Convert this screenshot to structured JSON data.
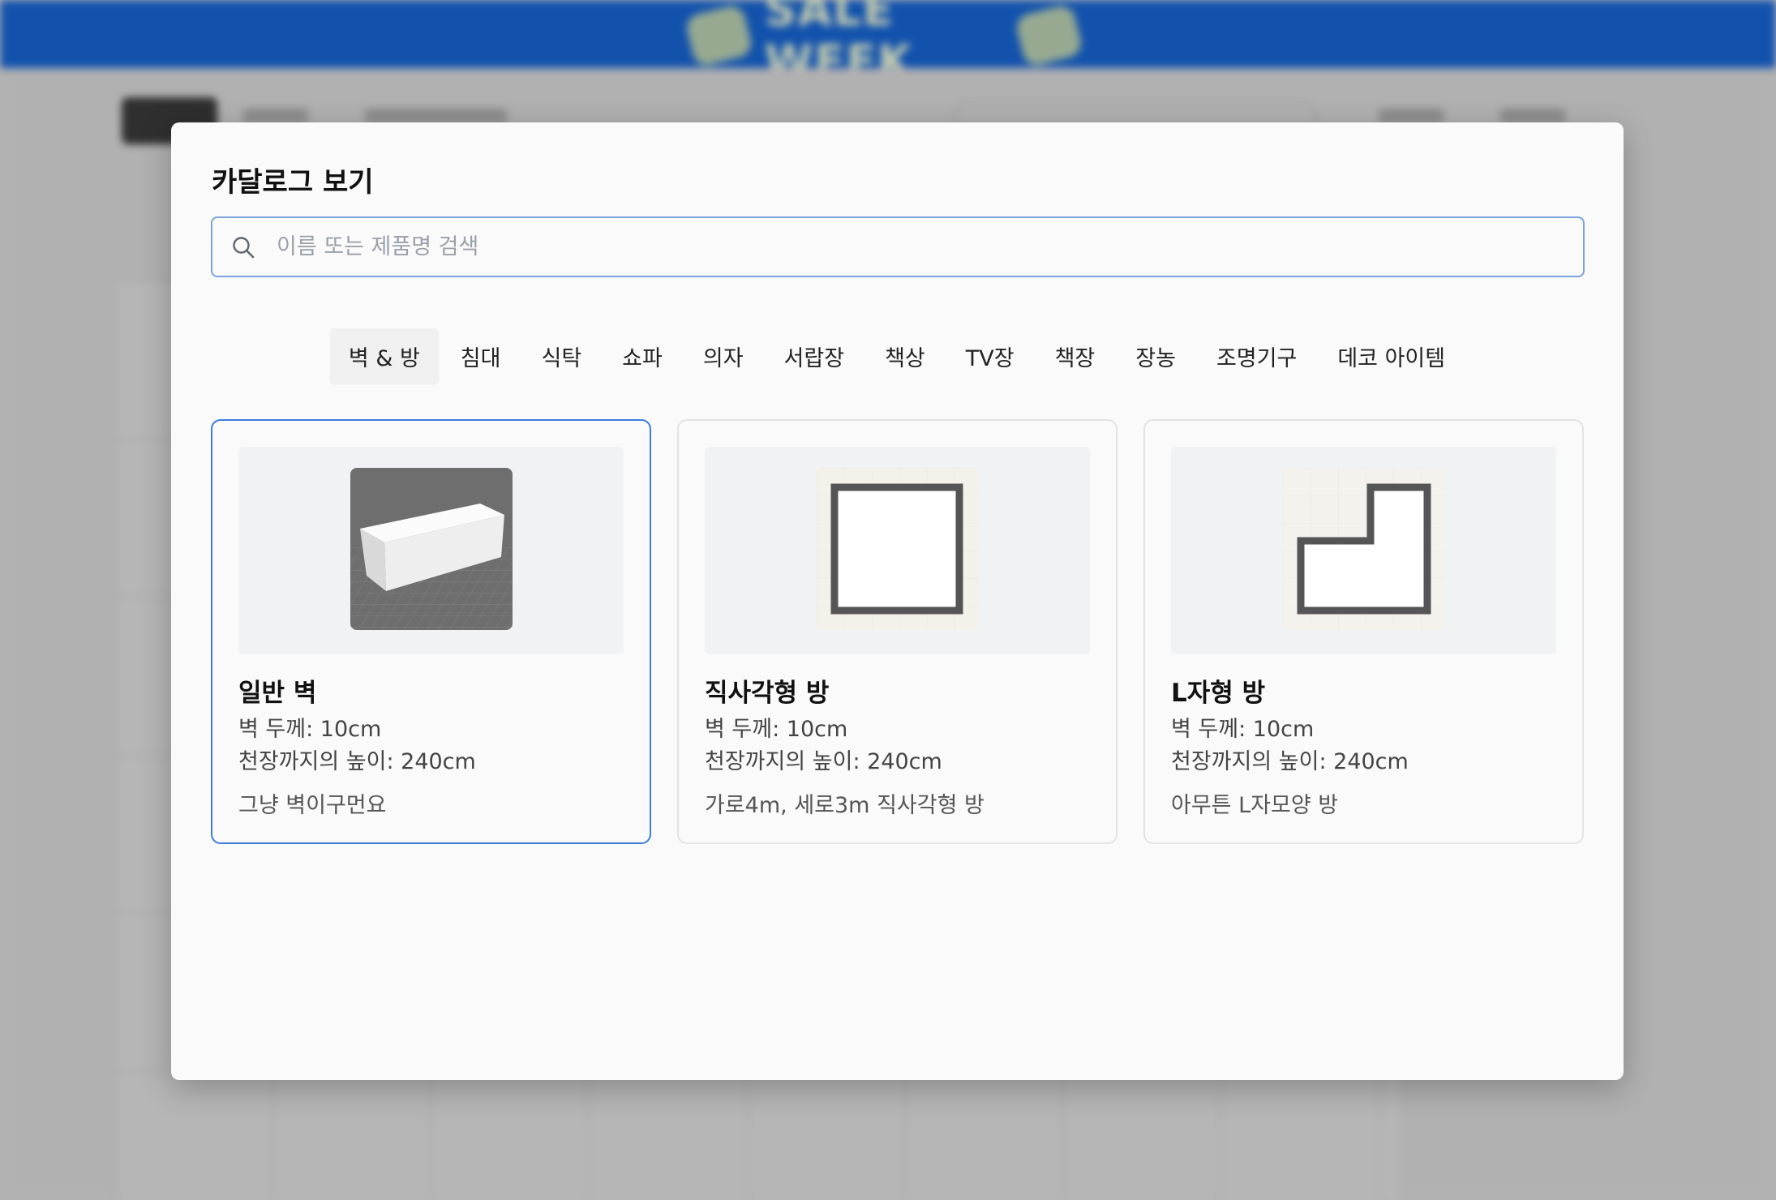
{
  "modal": {
    "title": "카달로그 보기",
    "search": {
      "placeholder": "이름 또는 제품명 검색",
      "value": ""
    },
    "tabs": [
      {
        "label": "벽 & 방",
        "active": true
      },
      {
        "label": "침대"
      },
      {
        "label": "식탁"
      },
      {
        "label": "쇼파"
      },
      {
        "label": "의자"
      },
      {
        "label": "서랍장"
      },
      {
        "label": "책상"
      },
      {
        "label": "TV장"
      },
      {
        "label": "책장"
      },
      {
        "label": "장농"
      },
      {
        "label": "조명기구"
      },
      {
        "label": "데코 아이템"
      }
    ],
    "cards": [
      {
        "title": "일반 벽",
        "thickness": "벽 두께: 10cm",
        "height": "천장까지의 높이: 240cm",
        "description": "그냥 벽이구먼요",
        "selected": true,
        "icon": "wall-block-icon"
      },
      {
        "title": "직사각형 방",
        "thickness": "벽 두께: 10cm",
        "height": "천장까지의 높이: 240cm",
        "description": "가로4m, 세로3m 직사각형 방",
        "icon": "rectangle-room-icon"
      },
      {
        "title": "L자형 방",
        "thickness": "벽 두께: 10cm",
        "height": "천장까지의 높이: 240cm",
        "description": "아무튼 L자모양 방",
        "icon": "l-shaped-room-icon"
      }
    ]
  },
  "colors": {
    "accent": "#3b7de0",
    "banner": "#1252ad",
    "overlay": "#b4b4b4"
  }
}
